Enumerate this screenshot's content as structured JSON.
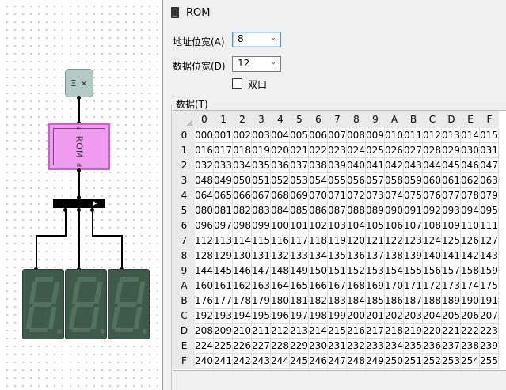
{
  "window": {
    "title": "ROM"
  },
  "canvas": {
    "input": {
      "left_glyph": "Ξ",
      "right_glyph": "×"
    },
    "rom_label": "ROM",
    "rom_pin_top": "a",
    "rom_pin_bottom": "d"
  },
  "properties": {
    "address_width_label": "地址位宽(A)",
    "address_width_value": "8",
    "data_width_label": "数据位宽(D)",
    "data_width_value": "12",
    "dual_port_label": "双口",
    "dual_port_checked": false,
    "data_label": "数据(T)"
  },
  "grid": {
    "col_headers": [
      "0",
      "1",
      "2",
      "3",
      "4",
      "5",
      "6",
      "7",
      "8",
      "9",
      "A",
      "B",
      "C",
      "D",
      "E",
      "F"
    ],
    "row_headers": [
      "0",
      "1",
      "2",
      "3",
      "4",
      "5",
      "6",
      "7",
      "8",
      "9",
      "A",
      "B",
      "C",
      "D",
      "E",
      "F"
    ],
    "rows": [
      [
        "000",
        "001",
        "002",
        "003",
        "004",
        "005",
        "006",
        "007",
        "008",
        "009",
        "010",
        "011",
        "012",
        "013",
        "014",
        "015"
      ],
      [
        "016",
        "017",
        "018",
        "019",
        "020",
        "021",
        "022",
        "023",
        "024",
        "025",
        "026",
        "027",
        "028",
        "029",
        "030",
        "031"
      ],
      [
        "032",
        "033",
        "034",
        "035",
        "036",
        "037",
        "038",
        "039",
        "040",
        "041",
        "042",
        "043",
        "044",
        "045",
        "046",
        "047"
      ],
      [
        "048",
        "049",
        "050",
        "051",
        "052",
        "053",
        "054",
        "055",
        "056",
        "057",
        "058",
        "059",
        "060",
        "061",
        "062",
        "063"
      ],
      [
        "064",
        "065",
        "066",
        "067",
        "068",
        "069",
        "070",
        "071",
        "072",
        "073",
        "074",
        "075",
        "076",
        "077",
        "078",
        "079"
      ],
      [
        "080",
        "081",
        "082",
        "083",
        "084",
        "085",
        "086",
        "087",
        "088",
        "089",
        "090",
        "091",
        "092",
        "093",
        "094",
        "095"
      ],
      [
        "096",
        "097",
        "098",
        "099",
        "100",
        "101",
        "102",
        "103",
        "104",
        "105",
        "106",
        "107",
        "108",
        "109",
        "110",
        "111"
      ],
      [
        "112",
        "113",
        "114",
        "115",
        "116",
        "117",
        "118",
        "119",
        "120",
        "121",
        "122",
        "123",
        "124",
        "125",
        "126",
        "127"
      ],
      [
        "128",
        "129",
        "130",
        "131",
        "132",
        "133",
        "134",
        "135",
        "136",
        "137",
        "138",
        "139",
        "140",
        "141",
        "142",
        "143"
      ],
      [
        "144",
        "145",
        "146",
        "147",
        "148",
        "149",
        "150",
        "151",
        "152",
        "153",
        "154",
        "155",
        "156",
        "157",
        "158",
        "159"
      ],
      [
        "160",
        "161",
        "162",
        "163",
        "164",
        "165",
        "166",
        "167",
        "168",
        "169",
        "170",
        "171",
        "172",
        "173",
        "174",
        "175"
      ],
      [
        "176",
        "177",
        "178",
        "179",
        "180",
        "181",
        "182",
        "183",
        "184",
        "185",
        "186",
        "187",
        "188",
        "189",
        "190",
        "191"
      ],
      [
        "192",
        "193",
        "194",
        "195",
        "196",
        "197",
        "198",
        "199",
        "200",
        "201",
        "202",
        "203",
        "204",
        "205",
        "206",
        "207"
      ],
      [
        "208",
        "209",
        "210",
        "211",
        "212",
        "213",
        "214",
        "215",
        "216",
        "217",
        "218",
        "219",
        "220",
        "221",
        "222",
        "223"
      ],
      [
        "224",
        "225",
        "226",
        "227",
        "228",
        "229",
        "230",
        "231",
        "232",
        "233",
        "234",
        "235",
        "236",
        "237",
        "238",
        "239"
      ],
      [
        "240",
        "241",
        "242",
        "243",
        "244",
        "245",
        "246",
        "247",
        "248",
        "249",
        "250",
        "251",
        "252",
        "253",
        "254",
        "255"
      ]
    ]
  },
  "colors": {
    "rom_fill": "#ef9bef",
    "input_fill": "#b2cbc6",
    "display_fill": "#3f5a4b",
    "segment_off": "#52715f"
  }
}
